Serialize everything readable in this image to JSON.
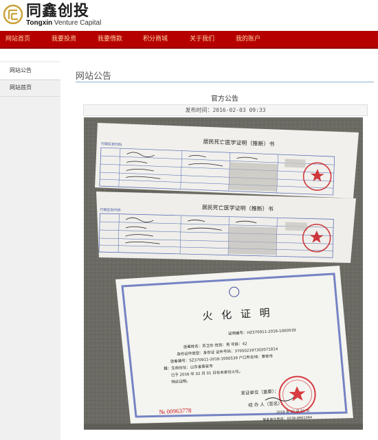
{
  "brand": {
    "name_cn": "同鑫创投",
    "name_en_bold": "Tongxin",
    "name_en_rest": " Venture Capital",
    "color_primary": "#b60000"
  },
  "nav": {
    "items": [
      {
        "label": "网站首页"
      },
      {
        "label": "我要投资"
      },
      {
        "label": "我要借款"
      },
      {
        "label": "积分商城"
      },
      {
        "label": "关于我们"
      },
      {
        "label": "我的账户"
      }
    ]
  },
  "sidebar": {
    "items": [
      {
        "label": "网站公告",
        "active": true
      },
      {
        "label": "网站首页",
        "active": false
      }
    ]
  },
  "main": {
    "page_title": "网站公告",
    "notice_title": "官方公告",
    "publish_label": "发布时间：",
    "publish_time": "2016-02-03 09:33"
  },
  "photo": {
    "icon": "document-photo",
    "cert1": {
      "title": "居民死亡医学证明（推断）书",
      "label_top": "行政区划代码"
    },
    "cert2": {
      "title": "居民死亡医学证明（推断）书",
      "label_top": "行政区划代码"
    },
    "cremation": {
      "title": "火 化 证 明",
      "number": "证明编号：HZ370911-2016-1000539",
      "line1": "逝者姓名：苏卫东  性别：男  年龄：42",
      "line2": "身份证件类型：身份证  证件号码：370502197302071814",
      "line3": "逝者编号：SZ370911-2016-1000539  户口所在地：泰安市",
      "line4": "籍：生前住址：山东省泰安市",
      "line5": "已于  2016  年  02  月  01  日在本单位火化。",
      "line6": "特此证明。",
      "issuer": "发证单位（盖章）：",
      "handler": "经 办 人（签名）：",
      "date": "2016 年 02 月 01 日",
      "phone": "联系单位电话：0538-8861044",
      "serial": "№ 00963778"
    }
  }
}
